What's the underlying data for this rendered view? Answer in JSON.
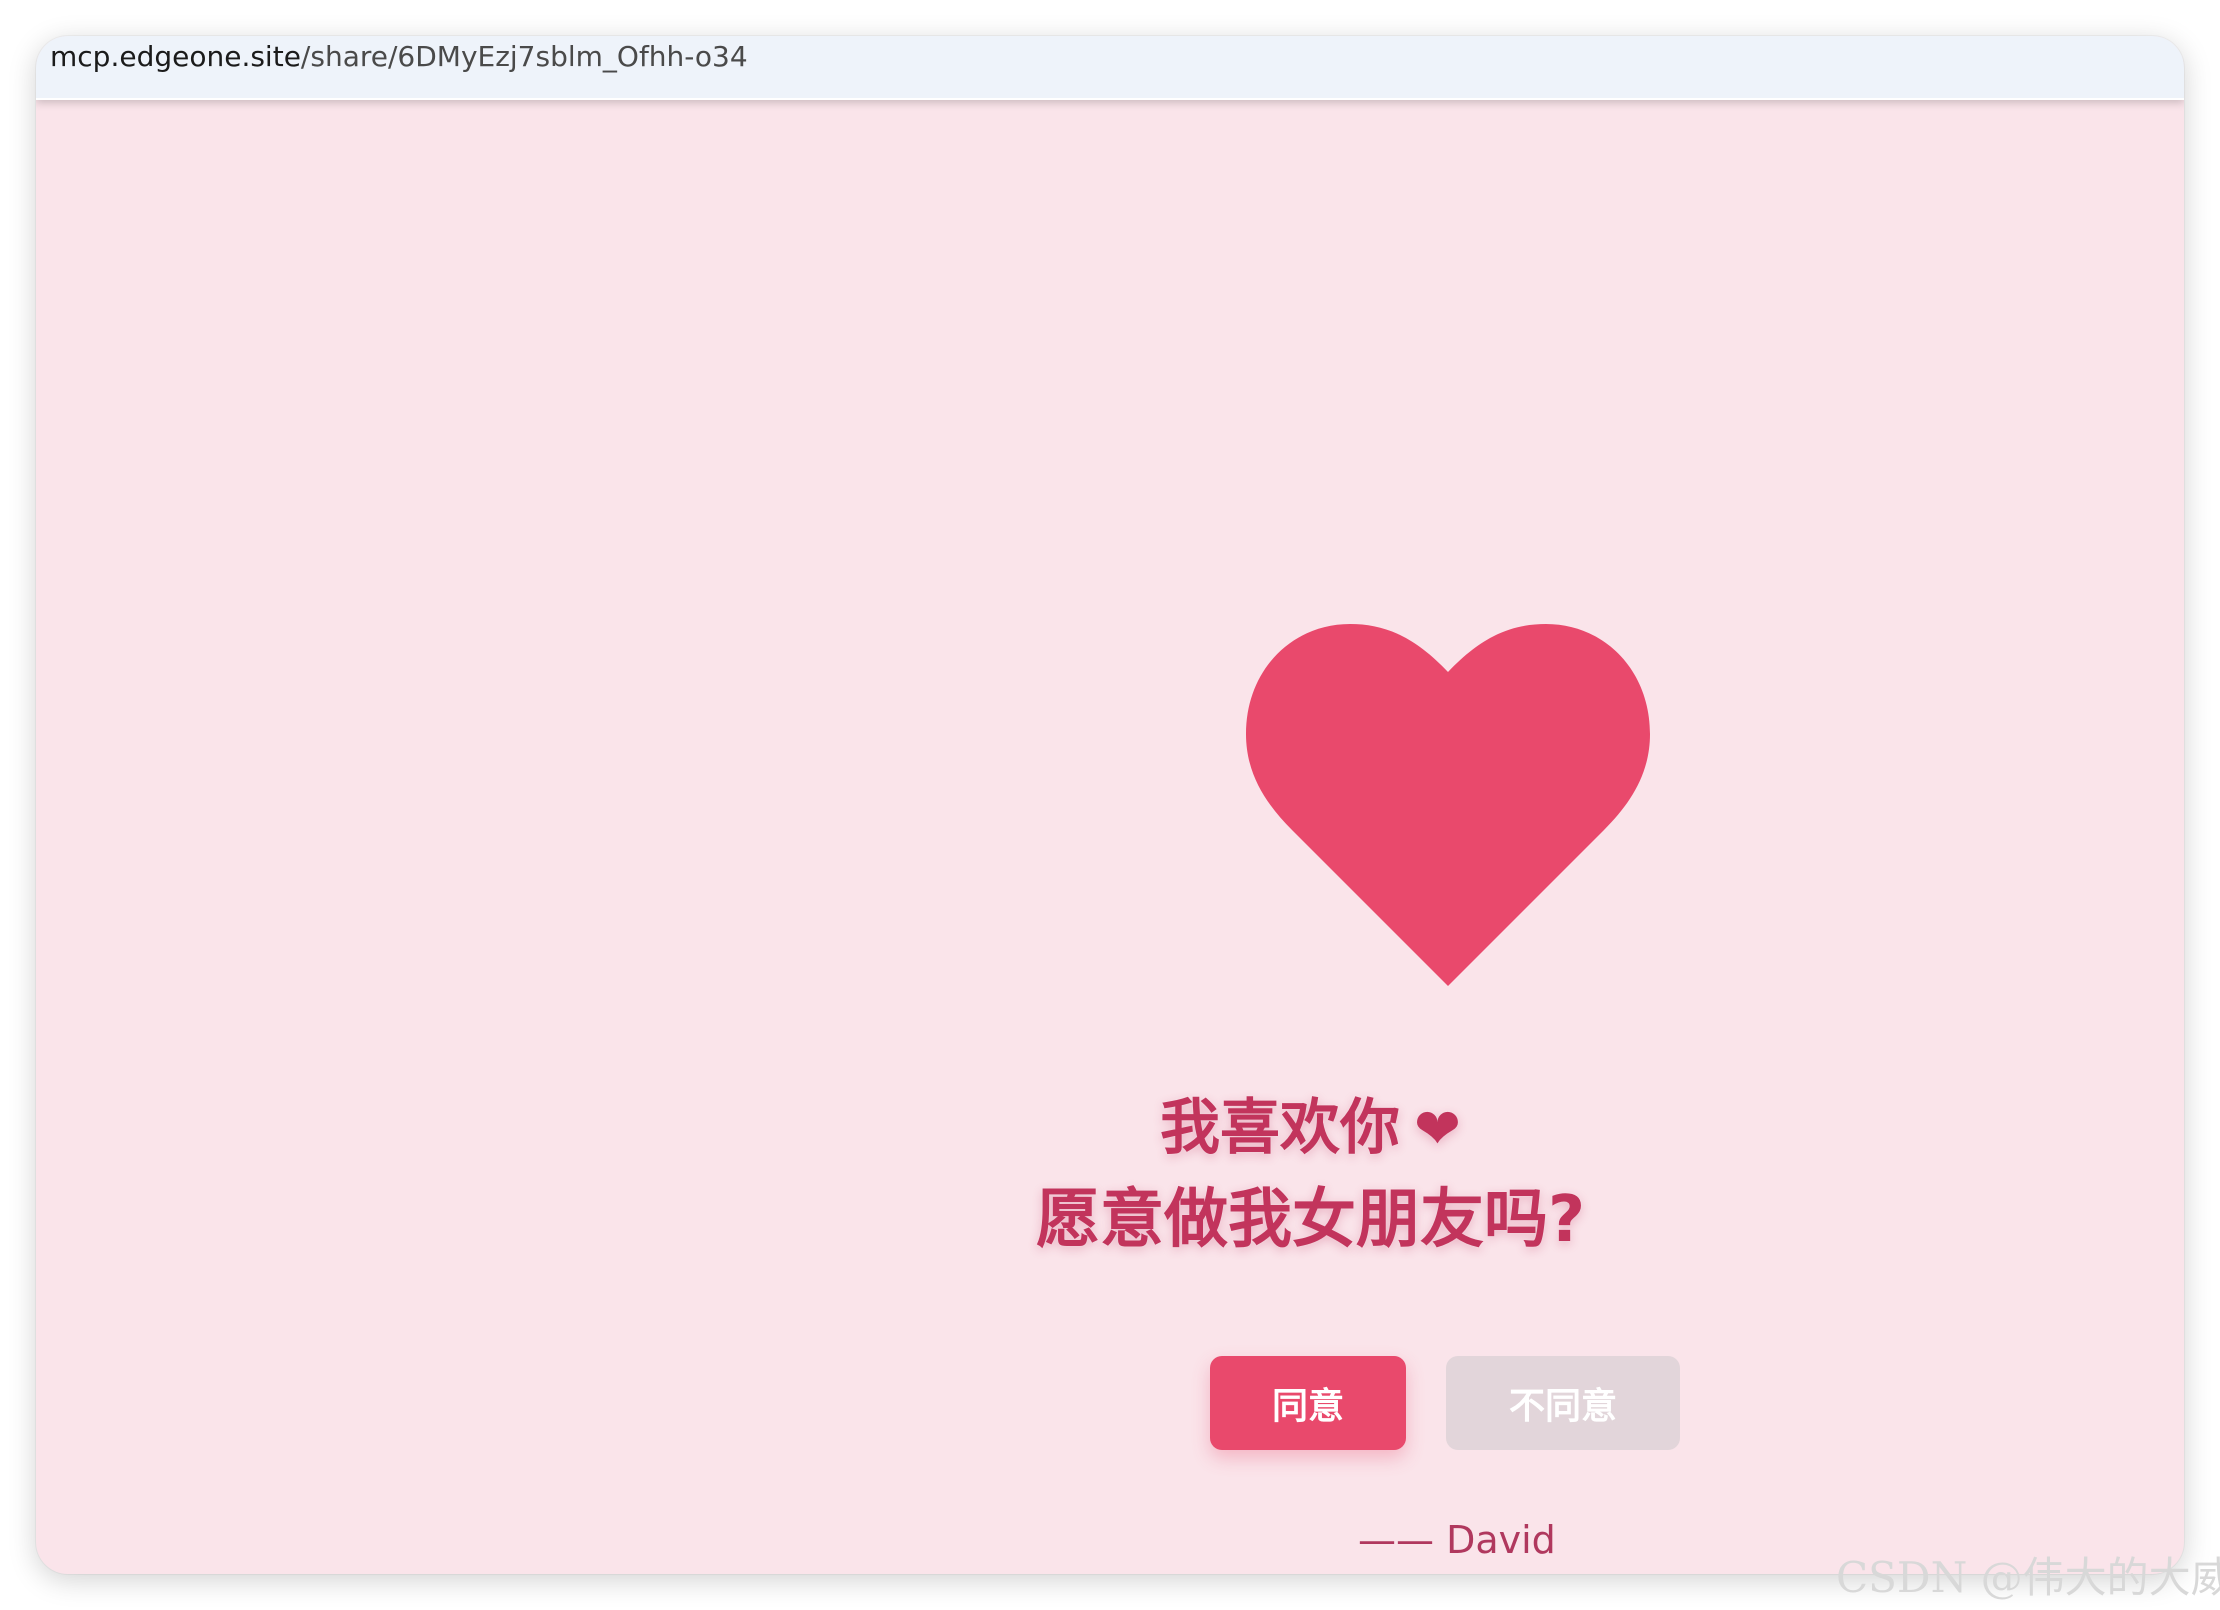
{
  "browser": {
    "url_host": "mcp.edgeone.site",
    "url_path": "/share/6DMyEzj7sblm_Ofhh-o34"
  },
  "page": {
    "heart_icon": "heart-icon",
    "heart_color": "#e9496c",
    "headline_line1": "我喜欢你",
    "headline_line1_icon": "❤",
    "headline_line2": "愿意做我女朋友吗?",
    "agree_button": "同意",
    "disagree_button": "不同意",
    "signature": "—— David",
    "colors": {
      "background": "#fae4ea",
      "accent": "#e9496c",
      "text": "#c2345c",
      "disabled_button": "#e2d5da"
    }
  },
  "watermark": "CSDN @伟大的大威"
}
